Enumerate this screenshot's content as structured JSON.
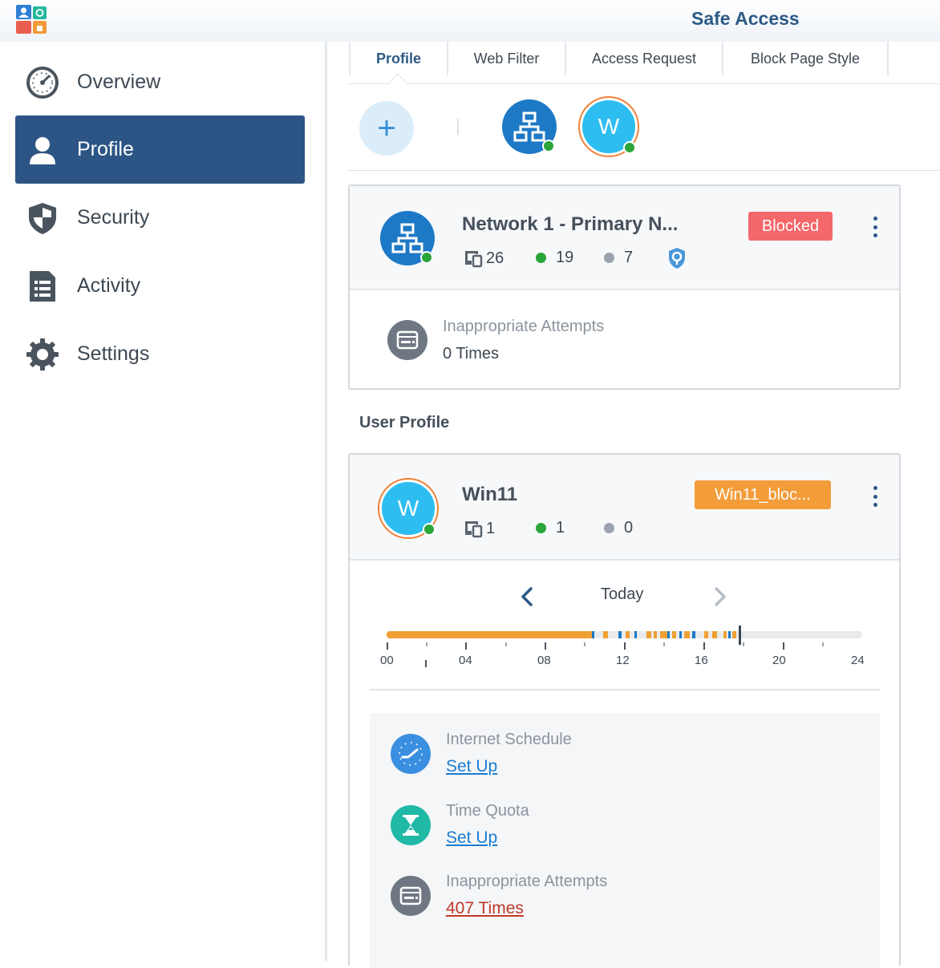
{
  "app": {
    "title": "Safe Access"
  },
  "sidebar": {
    "items": [
      {
        "label": "Overview",
        "icon": "gauge-icon",
        "active": false
      },
      {
        "label": "Profile",
        "icon": "person-icon",
        "active": true
      },
      {
        "label": "Security",
        "icon": "shield-icon",
        "active": false
      },
      {
        "label": "Activity",
        "icon": "list-document-icon",
        "active": false
      },
      {
        "label": "Settings",
        "icon": "gear-icon",
        "active": false
      }
    ]
  },
  "tabs": [
    {
      "label": "Profile",
      "active": true
    },
    {
      "label": "Web Filter",
      "active": false
    },
    {
      "label": "Access Request",
      "active": false
    },
    {
      "label": "Block Page Style",
      "active": false
    }
  ],
  "profile_bar": {
    "add_label": "+",
    "user_avatar_letter": "W"
  },
  "network_card": {
    "title": "Network 1 - Primary N...",
    "badge": "Blocked",
    "devices": "26",
    "online": "19",
    "offline": "7",
    "attempts_label": "Inappropriate Attempts",
    "attempts_value": "0 Times"
  },
  "section": {
    "user_profile_title": "User Profile"
  },
  "user_card": {
    "avatar_letter": "W",
    "title": "Win11",
    "badge": "Win11_bloc...",
    "devices": "1",
    "online": "1",
    "offline": "0",
    "day_label": "Today",
    "timeline_ticks": [
      "00",
      "04",
      "08",
      "12",
      "16",
      "20",
      "24"
    ],
    "schedule_label": "Internet Schedule",
    "schedule_link": "Set Up",
    "quota_label": "Time Quota",
    "quota_link": "Set Up",
    "attempts_label": "Inappropriate Attempts",
    "attempts_link": "407 Times"
  },
  "colors": {
    "accent": "#2c5585",
    "blocked": "#f4676a",
    "schedule_badge": "#f39c3a",
    "online": "#2aa53a",
    "offline": "#9aa3ad",
    "link": "#1a7dd1",
    "danger_link": "#c0392b",
    "timeline_usage": "#f0a033",
    "timeline_blue": "#1d79c6"
  }
}
